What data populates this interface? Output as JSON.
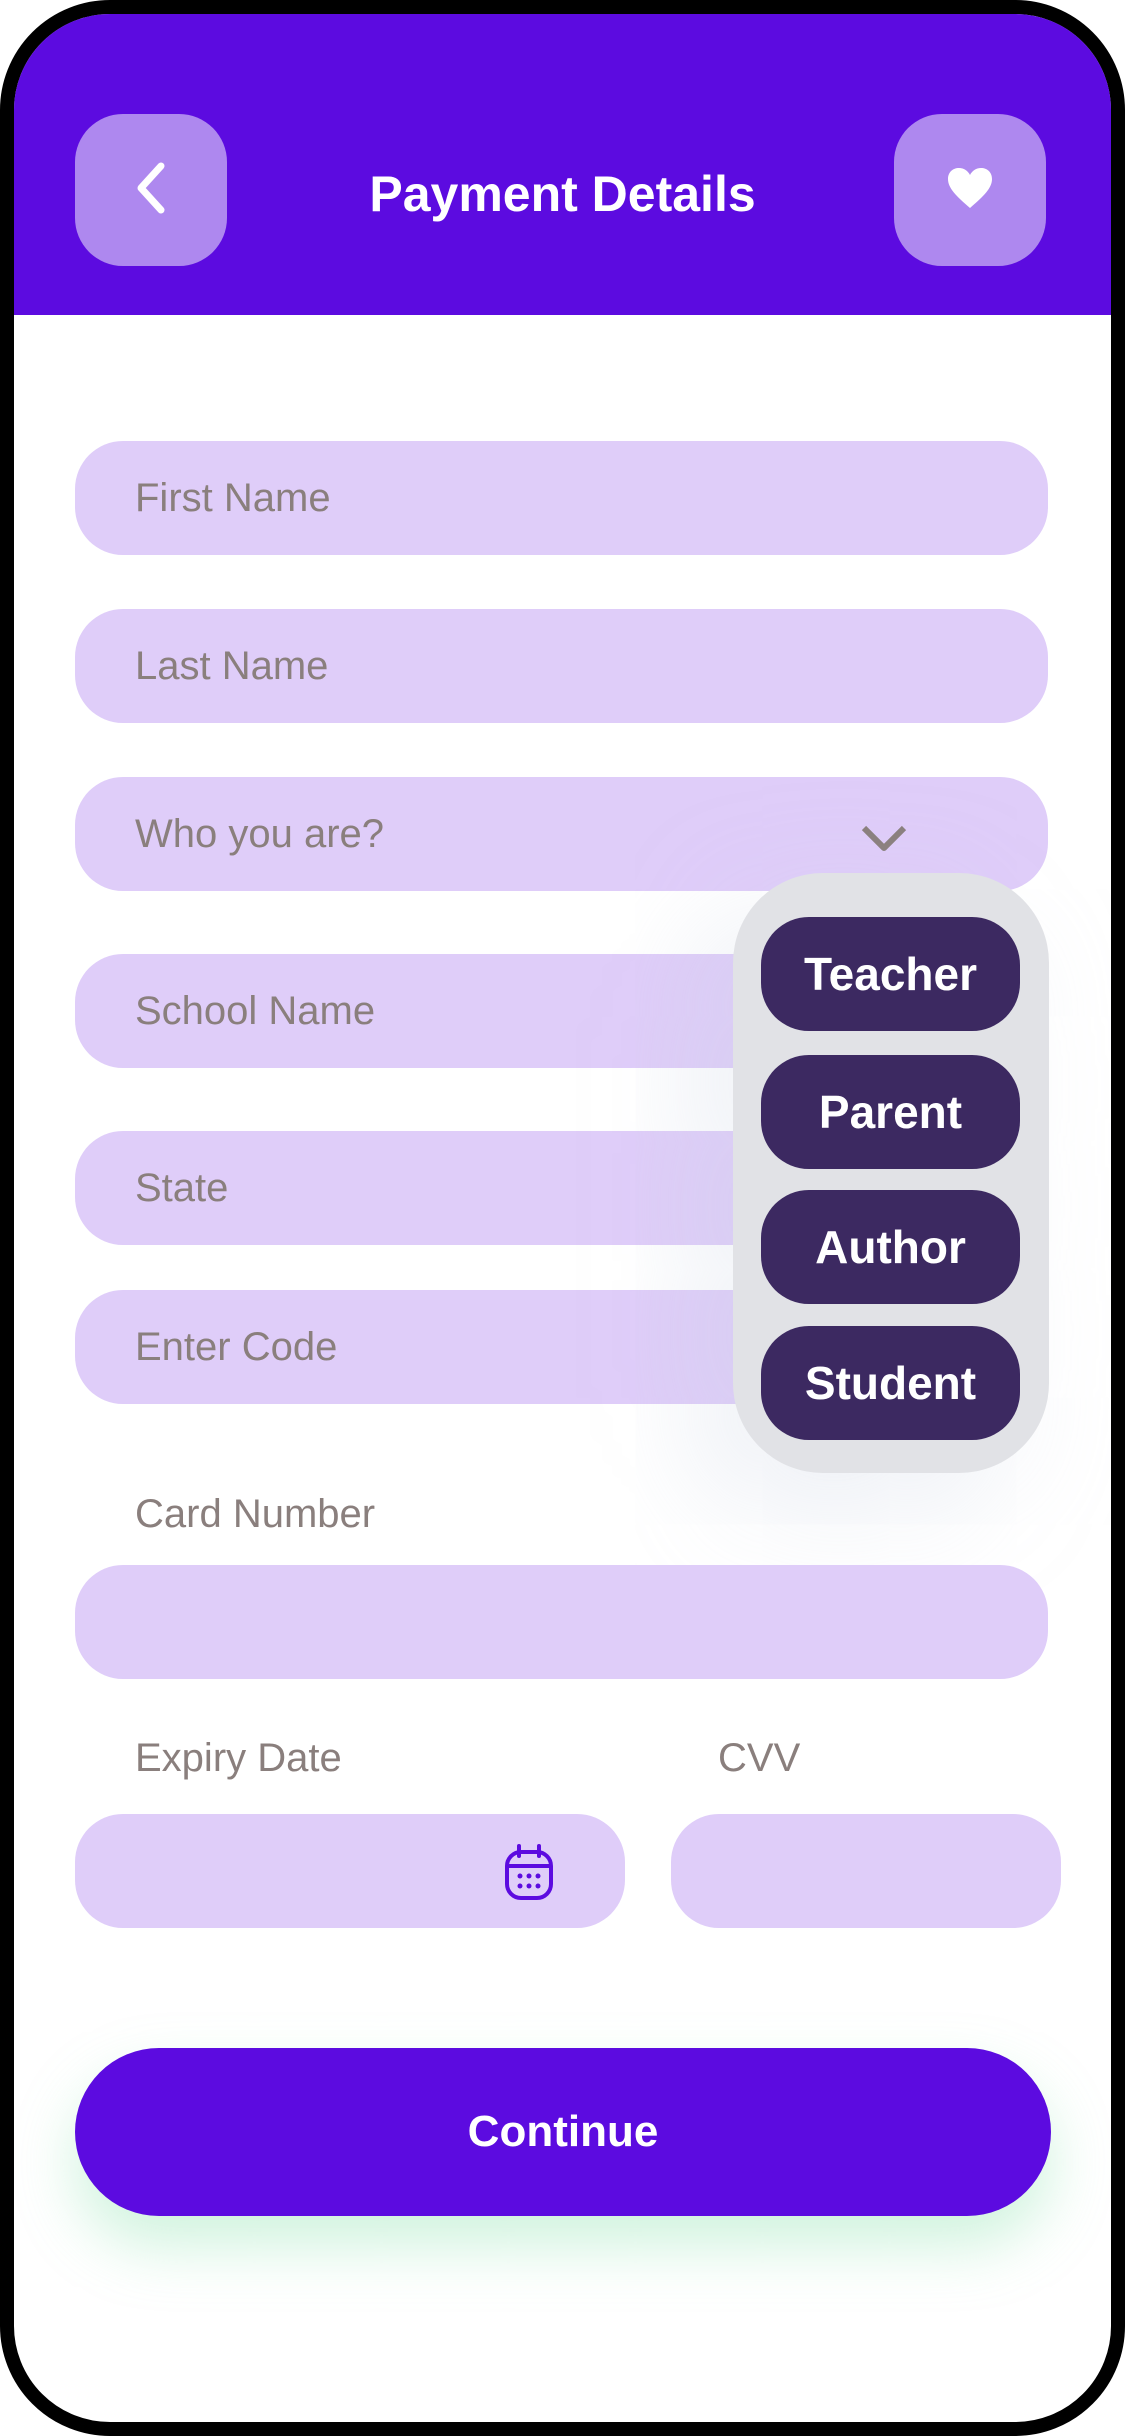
{
  "header": {
    "title": "Payment Details",
    "back_icon": "chevron-left-icon",
    "favorite_icon": "heart-icon",
    "background_color": "#5c0be0"
  },
  "form": {
    "first_name": {
      "placeholder": "First Name",
      "value": ""
    },
    "last_name": {
      "placeholder": "Last Name",
      "value": ""
    },
    "role_select": {
      "placeholder": "Who you are?",
      "icon": "chevron-down-icon",
      "options": [
        "Teacher",
        "Parent",
        "Author",
        "Student"
      ]
    },
    "school_name": {
      "placeholder": "School Name",
      "value": ""
    },
    "state": {
      "placeholder": "State",
      "value": ""
    },
    "code": {
      "placeholder": "Enter Code",
      "value": ""
    },
    "card_number": {
      "label": "Card Number",
      "value": ""
    },
    "expiry_date": {
      "label": "Expiry Date",
      "value": "",
      "icon": "calendar-icon"
    },
    "cvv": {
      "label": "CVV",
      "value": ""
    }
  },
  "actions": {
    "continue_label": "Continue"
  },
  "colors": {
    "primary": "#5c0be0",
    "field_bg": "#dfcdf9",
    "option_bg": "#3c2961",
    "dropdown_bg": "#e1e2e6",
    "placeholder_text": "#8a7f7d"
  }
}
